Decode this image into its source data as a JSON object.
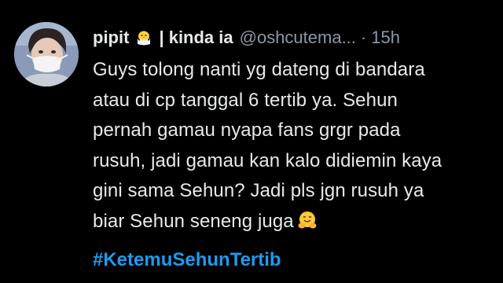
{
  "tweet": {
    "display_name": "pipit",
    "name_emoji": "hatching-chick-emoji",
    "name_suffix": "| kinda ia",
    "handle": "@oshcutema...",
    "separator": "·",
    "time": "15h",
    "lines": [
      "Guys tolong nanti yg dateng di bandara",
      "atau di cp tanggal 6 tertib ya. Sehun",
      "pernah gamau nyapa fans grgr pada",
      "rusuh, jadi gamau kan kalo didiemin kaya",
      "gini sama Sehun? Jadi pls jgn rusuh ya",
      "biar Sehun seneng juga"
    ],
    "end_emoji": "hugging-face-emoji",
    "hashtag": "#KetemuSehunTertib"
  },
  "colors": {
    "background": "#000000",
    "text": "#e7e9ea",
    "muted": "#8b98a5",
    "link": "#1d9bf0"
  }
}
